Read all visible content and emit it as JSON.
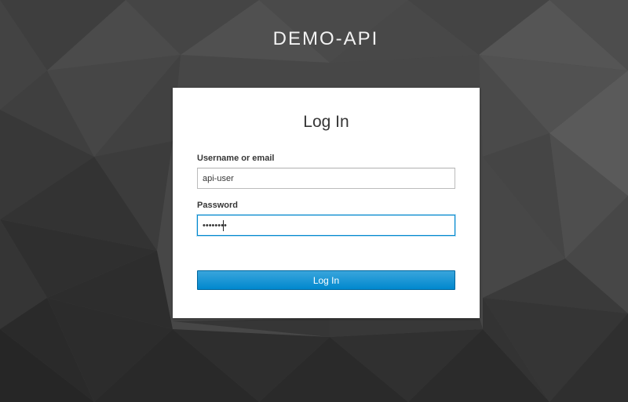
{
  "realm": {
    "title": "DEMO-API"
  },
  "login_form": {
    "title": "Log In",
    "username_label": "Username or email",
    "username_value": "api-user",
    "password_label": "Password",
    "password_value": "••••••••",
    "submit_label": "Log In"
  },
  "colors": {
    "background": "#4a4a4a",
    "primary_button": "#0088ce",
    "focus_border": "#0088ce",
    "card": "#ffffff",
    "text": "#363636"
  }
}
